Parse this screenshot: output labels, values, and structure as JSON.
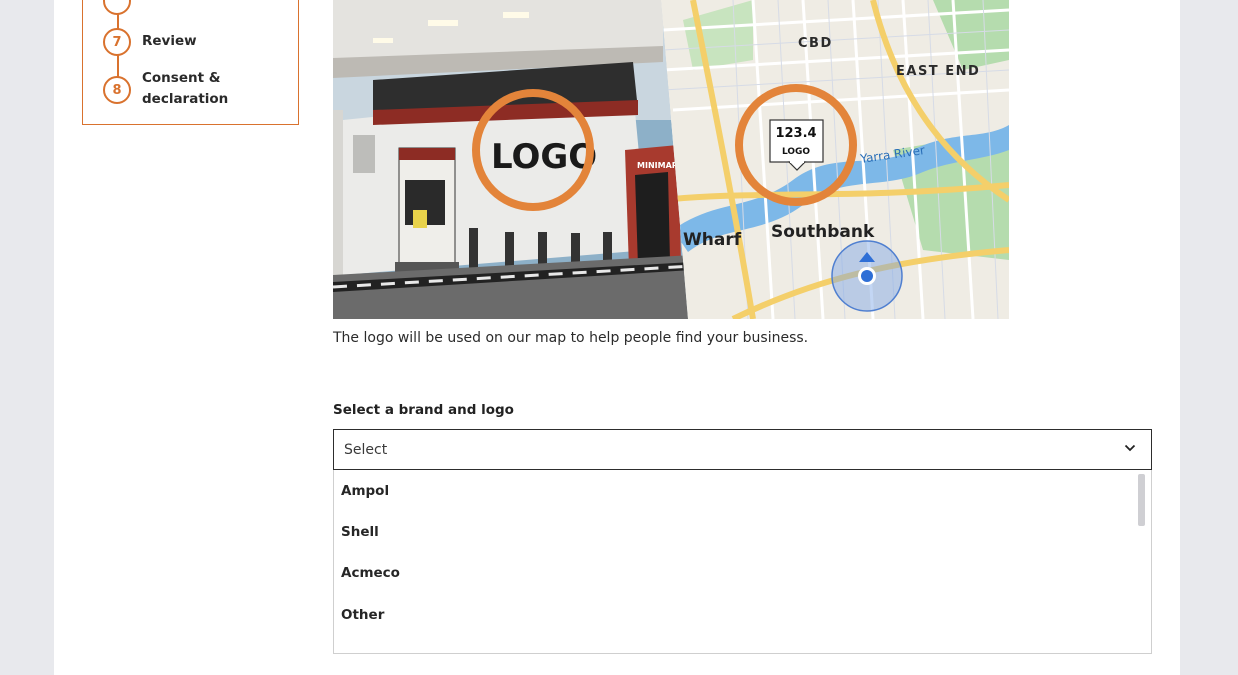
{
  "stepper": {
    "steps": [
      {
        "number": "",
        "label": ""
      },
      {
        "number": "7",
        "label": "Review"
      },
      {
        "number": "8",
        "label": "Consent & declaration"
      }
    ]
  },
  "hero": {
    "station_logo": "LOGO",
    "station_shop": "MINIMART",
    "map_labels": {
      "cbd": "CBD",
      "east_end": "EAST END",
      "river": "Yarra River",
      "wharf": "Wharf",
      "southbank": "Southbank"
    },
    "pin": {
      "price": "123.4",
      "logo": "LOGO"
    },
    "colors": {
      "accent": "#e3843a",
      "map_water": "#7db8e8",
      "map_park": "#b5dcae",
      "map_road": "#f4cf6a",
      "location_dot": "#2f6fd6"
    }
  },
  "caption": "The logo will be used on our map to help people find your business.",
  "brand_select": {
    "label": "Select a brand and logo",
    "value": "Select",
    "options": [
      "Ampol",
      "Shell",
      "Acmeco",
      "Other"
    ]
  },
  "icons": {
    "dropdown": "chevron-down-icon"
  }
}
